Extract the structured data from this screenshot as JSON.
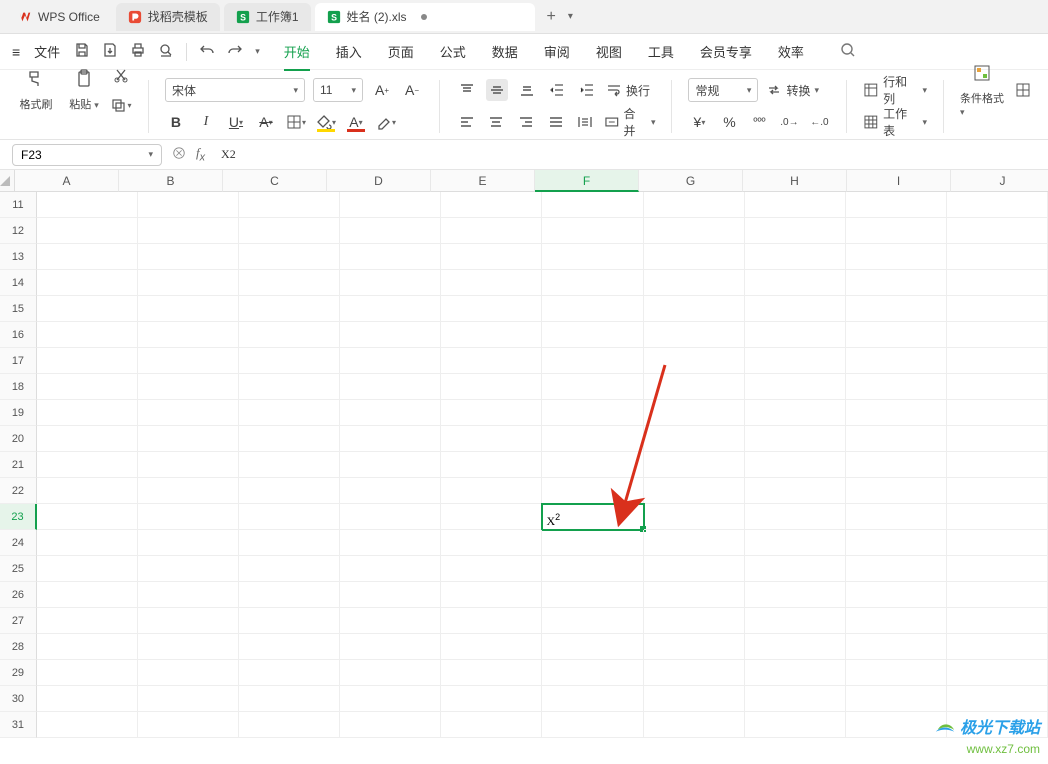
{
  "tabs": {
    "app": "WPS Office",
    "templates": "找稻壳模板",
    "wb1": "工作簿1",
    "wb2": "姓名 (2).xls"
  },
  "menu": {
    "file": "文件",
    "items": [
      "开始",
      "插入",
      "页面",
      "公式",
      "数据",
      "审阅",
      "视图",
      "工具",
      "会员专享",
      "效率"
    ],
    "active_index": 0
  },
  "ribbon": {
    "format_painter": "格式刷",
    "paste": "粘贴",
    "font_name": "宋体",
    "font_size": "11",
    "wrap": "换行",
    "merge": "合并",
    "number_format": "常规",
    "convert": "转换",
    "rows_cols": "行和列",
    "worksheet": "工作表",
    "cond_format": "条件格式"
  },
  "formula_bar": {
    "cell_ref": "F23",
    "formula": "X2"
  },
  "grid": {
    "columns": [
      "A",
      "B",
      "C",
      "D",
      "E",
      "F",
      "G",
      "H",
      "I",
      "J"
    ],
    "selected_col_index": 5,
    "row_start": 11,
    "row_end": 31,
    "selected_row": 23,
    "cell_value_base": "X",
    "cell_value_sup": "2"
  },
  "watermark": {
    "line1": "极光下载站",
    "line2": "www.xz7.com"
  }
}
